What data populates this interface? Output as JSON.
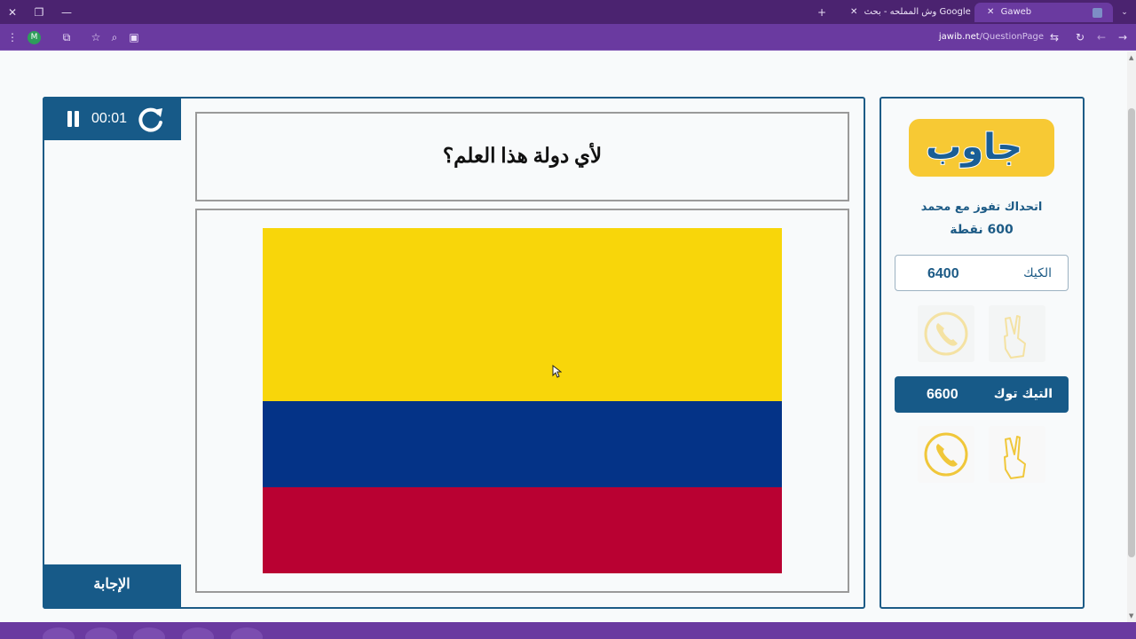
{
  "browser": {
    "tabs": [
      {
        "title": "Gaweb",
        "active": true
      },
      {
        "title": "وش المملحه - بحث Google",
        "active": false
      }
    ],
    "url_host": "jawib.net",
    "url_path": "/QuestionPage",
    "profile_initial": "M"
  },
  "game": {
    "timer": "00:01",
    "answer_button": "الإجابة",
    "question": "لأي دولة هذا العلم؟",
    "flag_colors": [
      "#f8d60a",
      "#043387",
      "#b90132"
    ],
    "flag_stripe_fractions": [
      0.5,
      0.25,
      0.25
    ]
  },
  "sidebar": {
    "logo_text": "جاوب",
    "challenge_text": "اتحداك تفوز مع محمد",
    "points_text": "600 نقطة",
    "teams": [
      {
        "name": "الكيك",
        "score": "6400",
        "active": false
      },
      {
        "name": "التيك توك",
        "score": "6600",
        "active": true
      }
    ]
  },
  "colors": {
    "brand_blue": "#175a88",
    "logo_yellow": "#f7c934",
    "browser_purple": "#6a3aa0"
  }
}
